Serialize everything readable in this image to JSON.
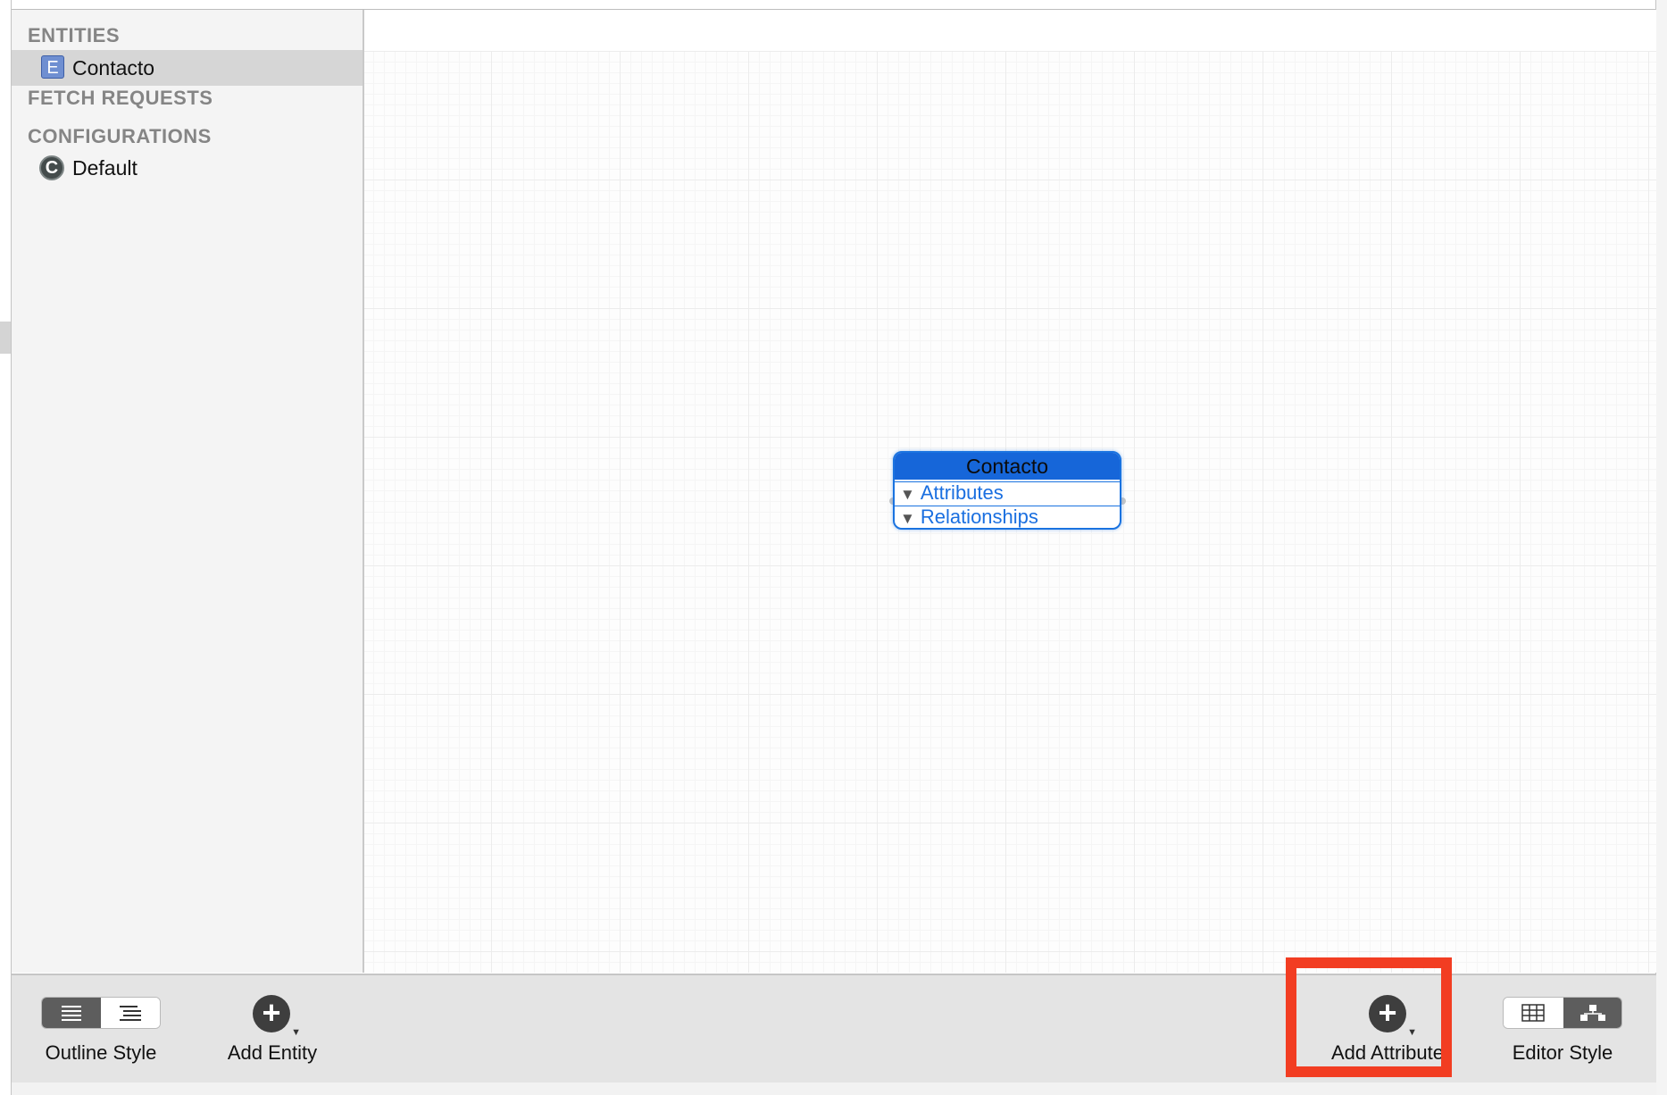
{
  "sidebar": {
    "entities_header": "ENTITIES",
    "entities": [
      {
        "name": "Contacto",
        "icon_letter": "E"
      }
    ],
    "fetch_requests_header": "FETCH REQUESTS",
    "configurations_header": "CONFIGURATIONS",
    "configurations": [
      {
        "name": "Default",
        "icon_letter": "C"
      }
    ]
  },
  "canvas": {
    "entity_node": {
      "title": "Contacto",
      "sections": [
        "Attributes",
        "Relationships"
      ]
    }
  },
  "toolbar": {
    "outline_style_label": "Outline Style",
    "add_entity_label": "Add Entity",
    "add_attribute_label": "Add Attribute",
    "editor_style_label": "Editor Style"
  },
  "colors": {
    "highlight": "#f23d22",
    "entity_blue": "#1666d9",
    "entity_icon": "#6f8fd1"
  }
}
